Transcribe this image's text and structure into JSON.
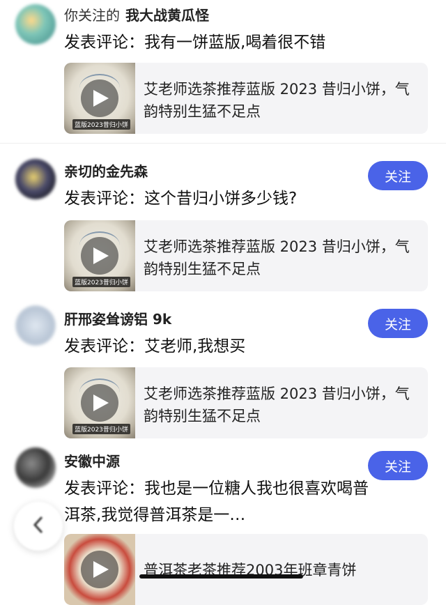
{
  "feed": [
    {
      "prefix": "你关注的",
      "name": "我大战黄瓜怪",
      "comment": "发表评论：我有一饼蓝版,喝着很不错",
      "card_title": "艾老师选茶推荐蓝版 2023 昔归小饼，气韵特别生猛不足点",
      "thumb_caption": "蓝版2023昔归小饼",
      "follow": "",
      "avatar_color": "#5fa8a0"
    },
    {
      "prefix": "",
      "name": "亲切的金先森",
      "comment": "发表评论：这个昔归小饼多少钱?",
      "card_title": "艾老师选茶推荐蓝版 2023 昔归小饼，气韵特别生猛不足点",
      "thumb_caption": "蓝版2023昔归小饼",
      "follow": "关注",
      "avatar_color": "#4a4a6a"
    },
    {
      "prefix": "",
      "name": "肝邢姿耸谤铝 9k",
      "comment": "发表评论：艾老师,我想买",
      "card_title": "艾老师选茶推荐蓝版 2023 昔归小饼，气韵特别生猛不足点",
      "thumb_caption": "蓝版2023昔归小饼",
      "follow": "关注",
      "avatar_color": "#b9c6d6"
    },
    {
      "prefix": "",
      "name": "安徽中源",
      "comment": "发表评论：我也是一位糖人我也很喜欢喝普洱茶,我觉得普洱茶是一…",
      "card_title": "普洱茶老茶推荐2003年班章青饼",
      "thumb_caption": "",
      "follow": "关注",
      "avatar_color": "#3a3a3a"
    }
  ],
  "colors": {
    "accent": "#4a63e8",
    "card_bg": "#f4f4f6"
  },
  "icons": {
    "play": "play-icon",
    "back": "chevron-left-icon"
  }
}
